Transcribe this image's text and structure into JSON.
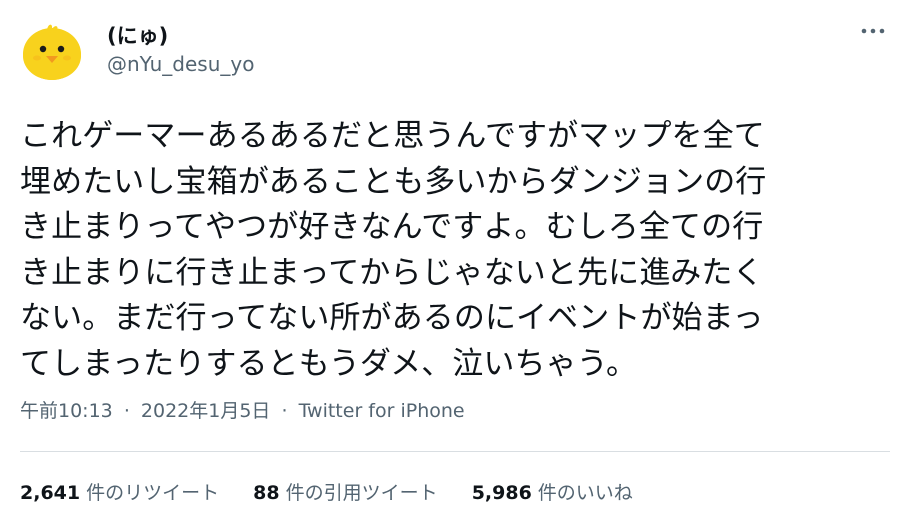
{
  "author": {
    "display_name": "(にゅ)",
    "handle": "@nYu_desu_yo",
    "avatar_icon": "chick-avatar-icon"
  },
  "menu": {
    "more_icon": "more-horizontal-icon"
  },
  "tweet_lines": [
    "これゲーマーあるあるだと思うんですがマップを全て",
    "埋めたいし宝箱があることも多いからダンジョンの行",
    "き止まりってやつが好きなんですよ。むしろ全ての行",
    "き止まりに行き止まってからじゃないと先に進みたく",
    "ない。まだ行ってない所があるのにイベントが始まっ",
    "てしまったりするともうダメ、泣いちゃう。"
  ],
  "meta": {
    "time": "午前10:13",
    "separator": "·",
    "date": "2022年1月5日",
    "source": "Twitter for iPhone"
  },
  "stats": {
    "retweets": {
      "count": "2,641",
      "label": "件のリツイート"
    },
    "quotes": {
      "count": "88",
      "label": "件の引用ツイート"
    },
    "likes": {
      "count": "5,986",
      "label": "件のいいね"
    }
  },
  "colors": {
    "primary_text": "#0f1419",
    "secondary_text": "#536471",
    "divider": "#d9dee2",
    "avatar_yellow": "#f8d21d",
    "avatar_beak": "#f29a1f"
  }
}
